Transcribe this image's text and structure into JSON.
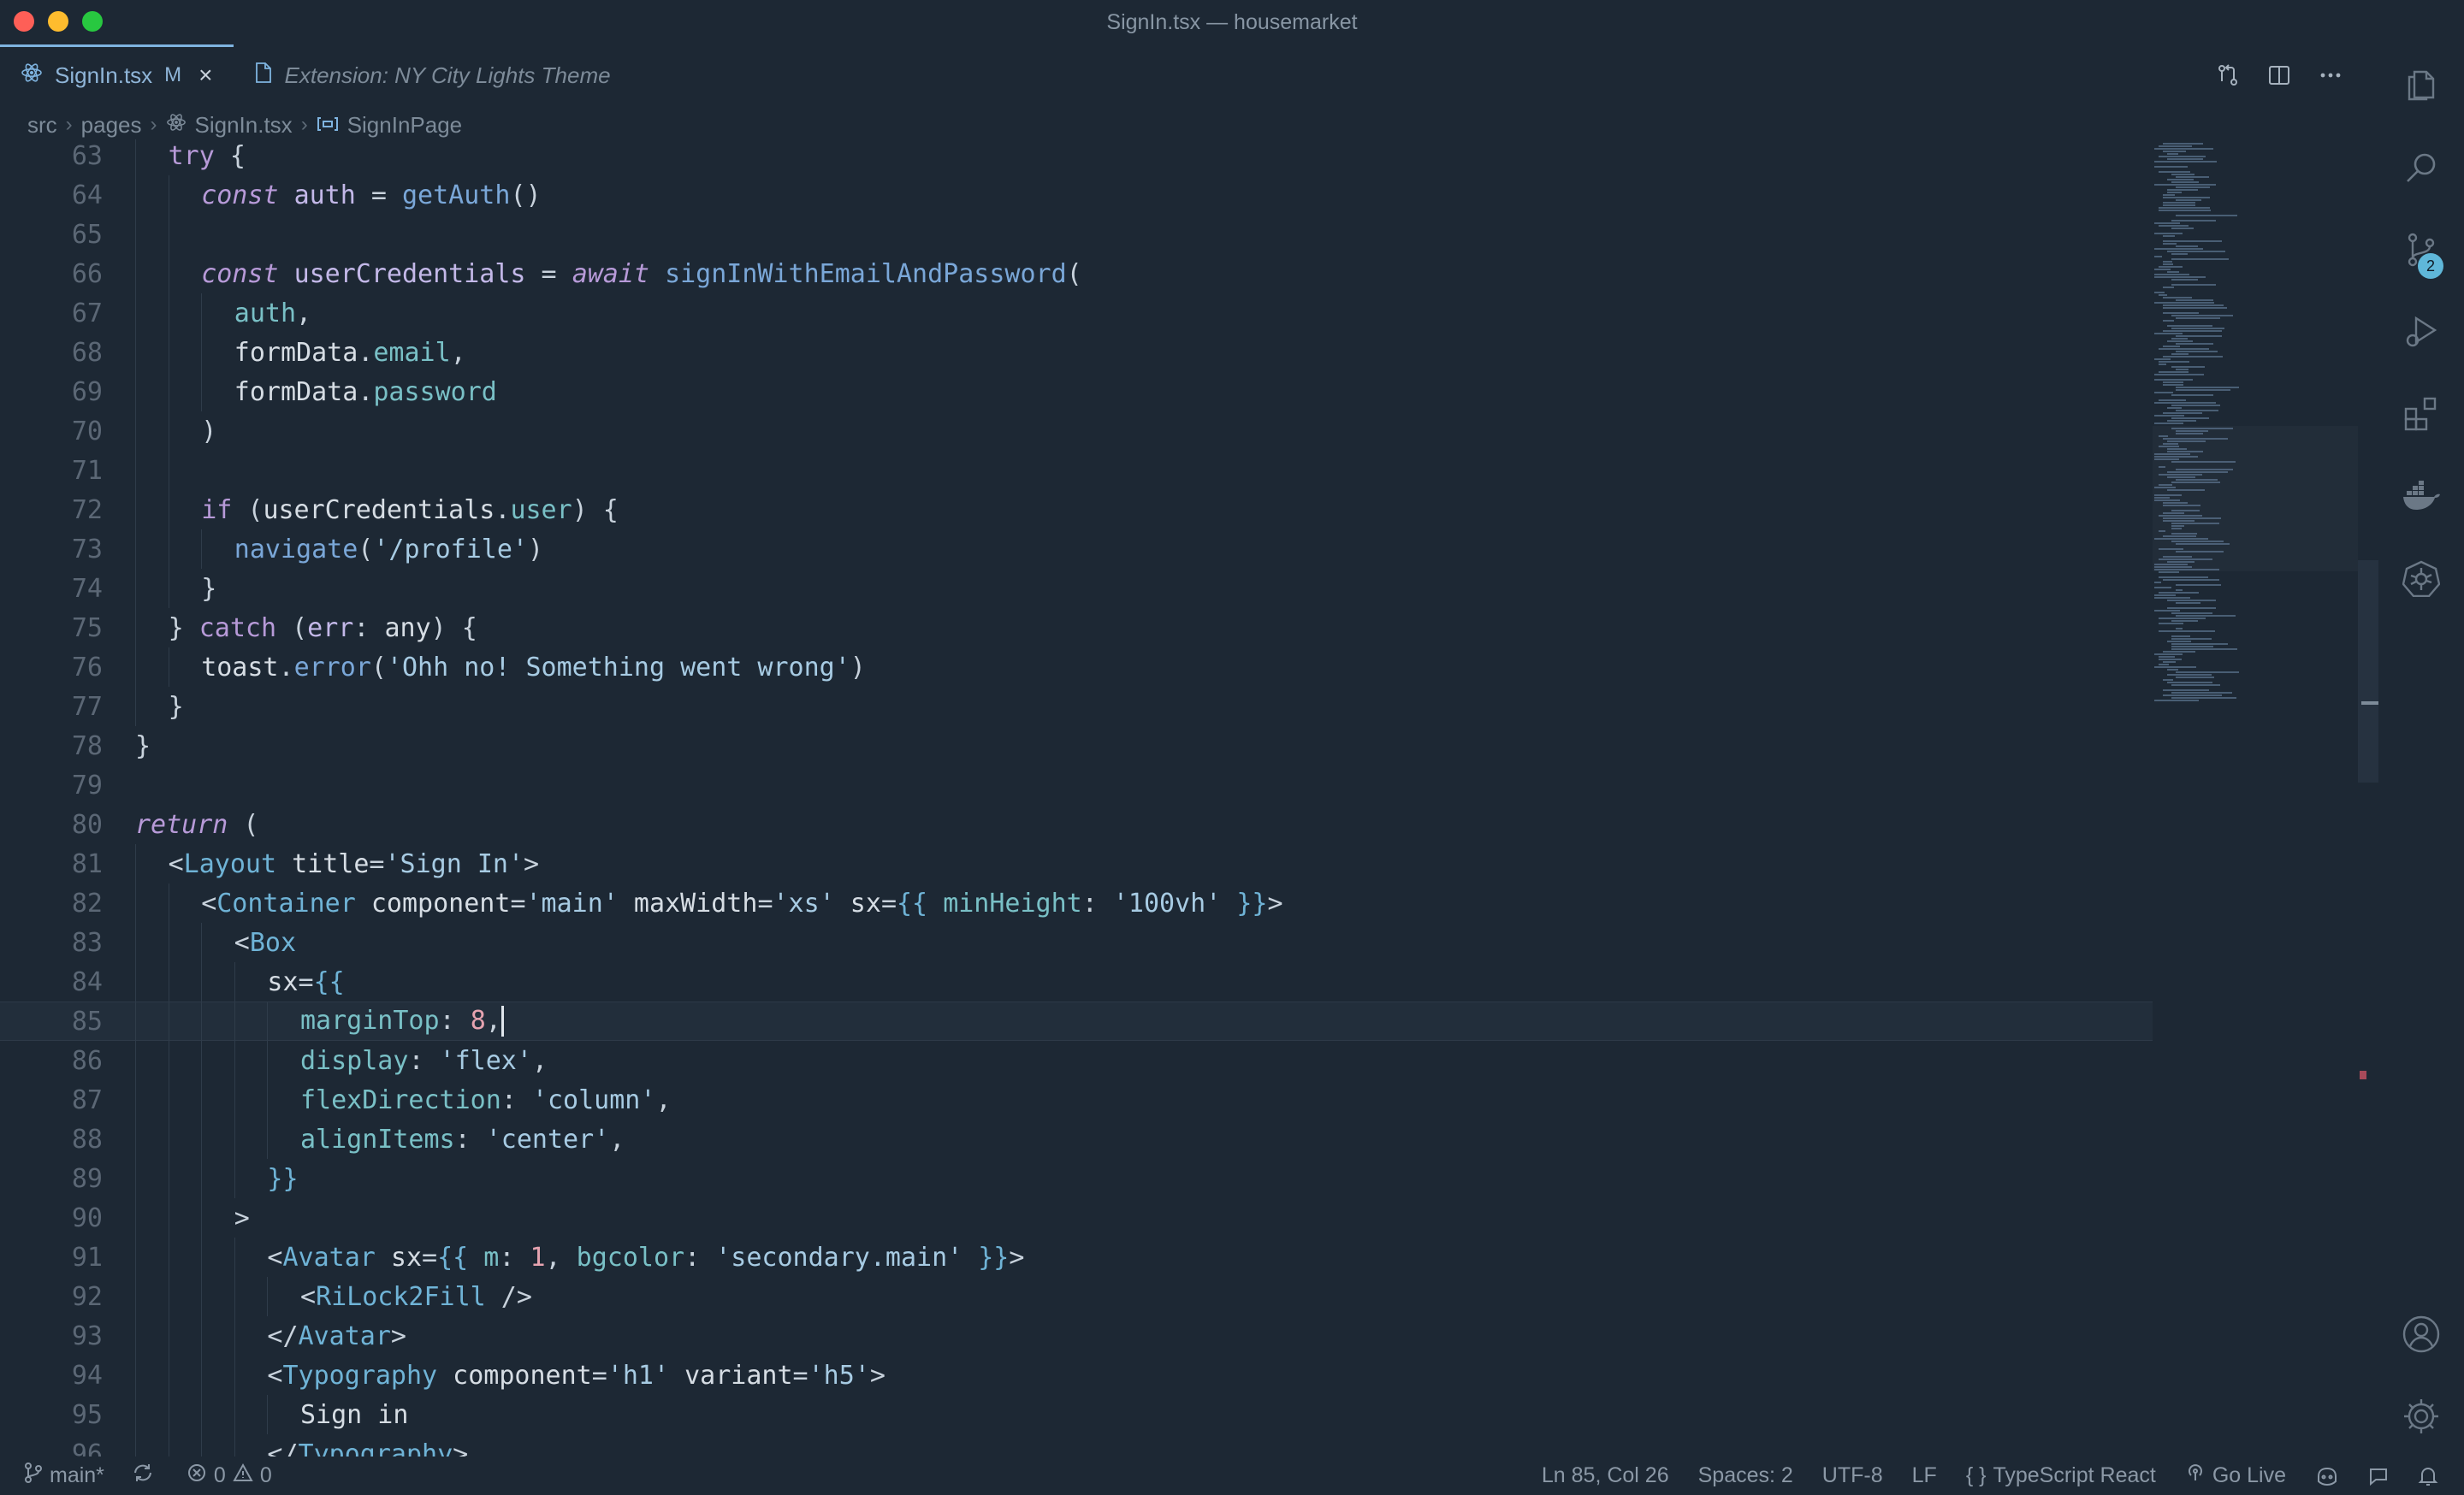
{
  "window": {
    "title": "SignIn.tsx — housemarket"
  },
  "tabs": [
    {
      "label": "SignIn.tsx",
      "modified": "M",
      "close": "×",
      "active": true
    },
    {
      "label": "Extension: NY City Lights Theme",
      "active": false
    }
  ],
  "breadcrumb": [
    "src",
    "pages",
    "SignIn.tsx",
    "SignInPage"
  ],
  "editor": {
    "cursor_line": 85,
    "lines": [
      {
        "n": "63",
        "indent": 1,
        "tokens": [
          [
            "kw2",
            "try"
          ],
          [
            "pun",
            " {"
          ]
        ]
      },
      {
        "n": "64",
        "indent": 2,
        "tokens": [
          [
            "kw",
            "const"
          ],
          [
            "plain",
            " "
          ],
          [
            "vari",
            "auth"
          ],
          [
            "pun",
            " = "
          ],
          [
            "fn",
            "getAuth"
          ],
          [
            "pun",
            "()"
          ]
        ]
      },
      {
        "n": "65",
        "indent": 2,
        "tokens": []
      },
      {
        "n": "66",
        "indent": 2,
        "tokens": [
          [
            "kw",
            "const"
          ],
          [
            "plain",
            " "
          ],
          [
            "vari",
            "userCredentials"
          ],
          [
            "pun",
            " = "
          ],
          [
            "kw",
            "await"
          ],
          [
            "plain",
            " "
          ],
          [
            "fn",
            "signInWithEmailAndPassword"
          ],
          [
            "pun",
            "("
          ]
        ]
      },
      {
        "n": "67",
        "indent": 3,
        "tokens": [
          [
            "prop",
            "auth"
          ],
          [
            "pun",
            ","
          ]
        ]
      },
      {
        "n": "68",
        "indent": 3,
        "tokens": [
          [
            "plain",
            "formData"
          ],
          [
            "pun",
            "."
          ],
          [
            "prop",
            "email"
          ],
          [
            "pun",
            ","
          ]
        ]
      },
      {
        "n": "69",
        "indent": 3,
        "tokens": [
          [
            "plain",
            "formData"
          ],
          [
            "pun",
            "."
          ],
          [
            "prop",
            "password"
          ]
        ]
      },
      {
        "n": "70",
        "indent": 2,
        "tokens": [
          [
            "pun",
            ")"
          ]
        ]
      },
      {
        "n": "71",
        "indent": 2,
        "tokens": []
      },
      {
        "n": "72",
        "indent": 2,
        "tokens": [
          [
            "kw2",
            "if"
          ],
          [
            "pun",
            " ("
          ],
          [
            "plain",
            "userCredentials"
          ],
          [
            "pun",
            "."
          ],
          [
            "prop",
            "user"
          ],
          [
            "pun",
            ") {"
          ]
        ]
      },
      {
        "n": "73",
        "indent": 3,
        "tokens": [
          [
            "fn",
            "navigate"
          ],
          [
            "pun",
            "("
          ],
          [
            "str",
            "'/profile'"
          ],
          [
            "pun",
            ")"
          ]
        ]
      },
      {
        "n": "74",
        "indent": 2,
        "tokens": [
          [
            "pun",
            "}"
          ]
        ]
      },
      {
        "n": "75",
        "indent": 1,
        "tokens": [
          [
            "pun",
            "} "
          ],
          [
            "kw2",
            "catch"
          ],
          [
            "pun",
            " ("
          ],
          [
            "vari",
            "err"
          ],
          [
            "pun",
            ": "
          ],
          [
            "plain",
            "any"
          ],
          [
            "pun",
            ") {"
          ]
        ]
      },
      {
        "n": "76",
        "indent": 2,
        "tokens": [
          [
            "plain",
            "toast"
          ],
          [
            "pun",
            "."
          ],
          [
            "fn",
            "error"
          ],
          [
            "pun",
            "("
          ],
          [
            "str",
            "'Ohh no! Something went wrong'"
          ],
          [
            "pun",
            ")"
          ]
        ]
      },
      {
        "n": "77",
        "indent": 1,
        "tokens": [
          [
            "pun",
            "}"
          ]
        ]
      },
      {
        "n": "78",
        "indent": 0,
        "tokens": [
          [
            "pun",
            "}"
          ]
        ]
      },
      {
        "n": "79",
        "indent": 0,
        "tokens": []
      },
      {
        "n": "80",
        "indent": 0,
        "tokens": [
          [
            "kw",
            "return"
          ],
          [
            "pun",
            " ("
          ]
        ]
      },
      {
        "n": "81",
        "indent": 1,
        "tokens": [
          [
            "pun",
            "<"
          ],
          [
            "tag",
            "Layout"
          ],
          [
            "plain",
            " title"
          ],
          [
            "pun",
            "="
          ],
          [
            "str",
            "'Sign In'"
          ],
          [
            "pun",
            ">"
          ]
        ]
      },
      {
        "n": "82",
        "indent": 2,
        "tokens": [
          [
            "pun",
            "<"
          ],
          [
            "tag",
            "Container"
          ],
          [
            "plain",
            " component"
          ],
          [
            "pun",
            "="
          ],
          [
            "str",
            "'main'"
          ],
          [
            "plain",
            " maxWidth"
          ],
          [
            "pun",
            "="
          ],
          [
            "str",
            "'xs'"
          ],
          [
            "plain",
            " sx"
          ],
          [
            "pun",
            "="
          ],
          [
            "brk",
            "{{"
          ],
          [
            "plain",
            " "
          ],
          [
            "prop",
            "minHeight"
          ],
          [
            "pun",
            ": "
          ],
          [
            "str",
            "'100vh'"
          ],
          [
            "plain",
            " "
          ],
          [
            "brk",
            "}}"
          ],
          [
            "pun",
            ">"
          ]
        ]
      },
      {
        "n": "83",
        "indent": 3,
        "tokens": [
          [
            "pun",
            "<"
          ],
          [
            "tag",
            "Box"
          ]
        ]
      },
      {
        "n": "84",
        "indent": 4,
        "tokens": [
          [
            "plain",
            "sx"
          ],
          [
            "pun",
            "="
          ],
          [
            "brk",
            "{{"
          ]
        ]
      },
      {
        "n": "85",
        "indent": 5,
        "tokens": [
          [
            "prop",
            "marginTop"
          ],
          [
            "pun",
            ": "
          ],
          [
            "num",
            "8"
          ],
          [
            "pun",
            ","
          ]
        ]
      },
      {
        "n": "86",
        "indent": 5,
        "tokens": [
          [
            "prop",
            "display"
          ],
          [
            "pun",
            ": "
          ],
          [
            "str",
            "'flex'"
          ],
          [
            "pun",
            ","
          ]
        ]
      },
      {
        "n": "87",
        "indent": 5,
        "tokens": [
          [
            "prop",
            "flexDirection"
          ],
          [
            "pun",
            ": "
          ],
          [
            "str",
            "'column'"
          ],
          [
            "pun",
            ","
          ]
        ]
      },
      {
        "n": "88",
        "indent": 5,
        "tokens": [
          [
            "prop",
            "alignItems"
          ],
          [
            "pun",
            ": "
          ],
          [
            "str",
            "'center'"
          ],
          [
            "pun",
            ","
          ]
        ]
      },
      {
        "n": "89",
        "indent": 4,
        "tokens": [
          [
            "brk",
            "}}"
          ]
        ]
      },
      {
        "n": "90",
        "indent": 3,
        "tokens": [
          [
            "pun",
            ">"
          ]
        ]
      },
      {
        "n": "91",
        "indent": 4,
        "tokens": [
          [
            "pun",
            "<"
          ],
          [
            "tag",
            "Avatar"
          ],
          [
            "plain",
            " sx"
          ],
          [
            "pun",
            "="
          ],
          [
            "brk",
            "{{"
          ],
          [
            "plain",
            " "
          ],
          [
            "prop",
            "m"
          ],
          [
            "pun",
            ": "
          ],
          [
            "num",
            "1"
          ],
          [
            "pun",
            ", "
          ],
          [
            "prop",
            "bgcolor"
          ],
          [
            "pun",
            ": "
          ],
          [
            "str",
            "'secondary.main'"
          ],
          [
            "plain",
            " "
          ],
          [
            "brk",
            "}}"
          ],
          [
            "pun",
            ">"
          ]
        ]
      },
      {
        "n": "92",
        "indent": 5,
        "tokens": [
          [
            "pun",
            "<"
          ],
          [
            "tag",
            "RiLock2Fill"
          ],
          [
            "pun",
            " />"
          ]
        ]
      },
      {
        "n": "93",
        "indent": 4,
        "tokens": [
          [
            "pun",
            "</"
          ],
          [
            "tag",
            "Avatar"
          ],
          [
            "pun",
            ">"
          ]
        ]
      },
      {
        "n": "94",
        "indent": 4,
        "tokens": [
          [
            "pun",
            "<"
          ],
          [
            "tag",
            "Typography"
          ],
          [
            "plain",
            " component"
          ],
          [
            "pun",
            "="
          ],
          [
            "str",
            "'h1'"
          ],
          [
            "plain",
            " variant"
          ],
          [
            "pun",
            "="
          ],
          [
            "str",
            "'h5'"
          ],
          [
            "pun",
            ">"
          ]
        ]
      },
      {
        "n": "95",
        "indent": 5,
        "tokens": [
          [
            "plain",
            "Sign in"
          ]
        ]
      },
      {
        "n": "96",
        "indent": 4,
        "tokens": [
          [
            "pun",
            "</"
          ],
          [
            "tag",
            "Typography"
          ],
          [
            "pun",
            ">"
          ]
        ]
      }
    ]
  },
  "activity_bar": {
    "items": [
      "explorer-icon",
      "search-icon",
      "source-control-icon",
      "run-debug-icon",
      "extensions-icon",
      "docker-icon",
      "kubernetes-icon",
      "account-icon",
      "settings-gear-icon"
    ],
    "source_control_badge": "2"
  },
  "statusbar": {
    "branch": "main*",
    "errors": "0",
    "warnings": "0",
    "position": "Ln 85, Col 26",
    "spaces": "Spaces: 2",
    "encoding": "UTF-8",
    "eol": "LF",
    "language_braces": "{ }",
    "language": "TypeScript React",
    "golive": "Go Live"
  },
  "colors": {
    "background": "#1d2834",
    "accent": "#7fb4e0",
    "badge": "#5fb7d9"
  }
}
